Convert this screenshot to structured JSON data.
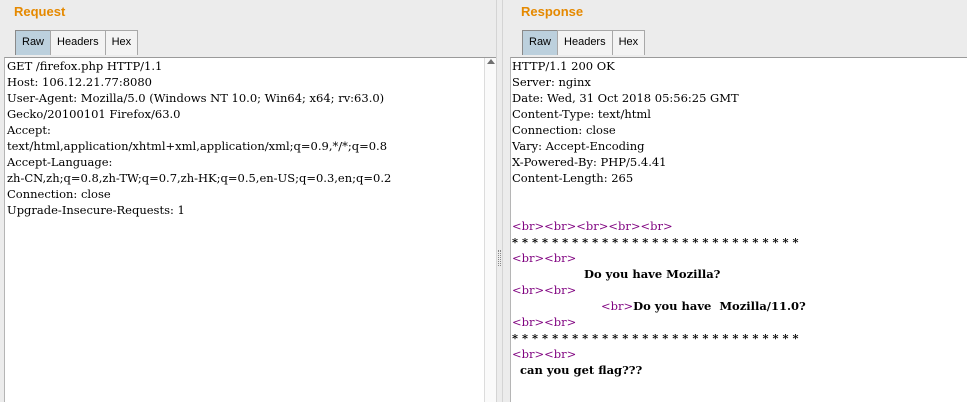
{
  "request": {
    "title": "Request",
    "tabs": [
      "Raw",
      "Headers",
      "Hex"
    ],
    "active_tab": "Raw",
    "lines": [
      "GET /firefox.php HTTP/1.1",
      "Host: 106.12.21.77:8080",
      "User-Agent: Mozilla/5.0 (Windows NT 10.0; Win64; x64; rv:63.0)",
      "Gecko/20100101 Firefox/63.0",
      "Accept:",
      "text/html,application/xhtml+xml,application/xml;q=0.9,*/*;q=0.8",
      "Accept-Language:",
      "zh-CN,zh;q=0.8,zh-TW;q=0.7,zh-HK;q=0.5,en-US;q=0.3,en;q=0.2",
      "Connection: close",
      "Upgrade-Insecure-Requests: 1"
    ]
  },
  "response": {
    "title": "Response",
    "tabs": [
      "Raw",
      "Headers",
      "Hex"
    ],
    "active_tab": "Raw",
    "header_lines": [
      "HTTP/1.1 200 OK",
      "Server: nginx",
      "Date: Wed, 31 Oct 2018 05:56:25 GMT",
      "Content-Type: text/html",
      "Connection: close",
      "Vary: Accept-Encoding",
      "X-Powered-By: PHP/5.4.41",
      "Content-Length: 265"
    ],
    "body": {
      "br5": "<br><br><br><br><br>",
      "br2": "<br><br>",
      "br1": "<br>",
      "stars": "* * * * * * * * * * * * * * * * * * * * * * * * * * * * *",
      "question1": "Do you have Mozilla?",
      "question2": "Do you have  Mozilla/11.0?",
      "flag_text": "can you get flag???"
    }
  }
}
